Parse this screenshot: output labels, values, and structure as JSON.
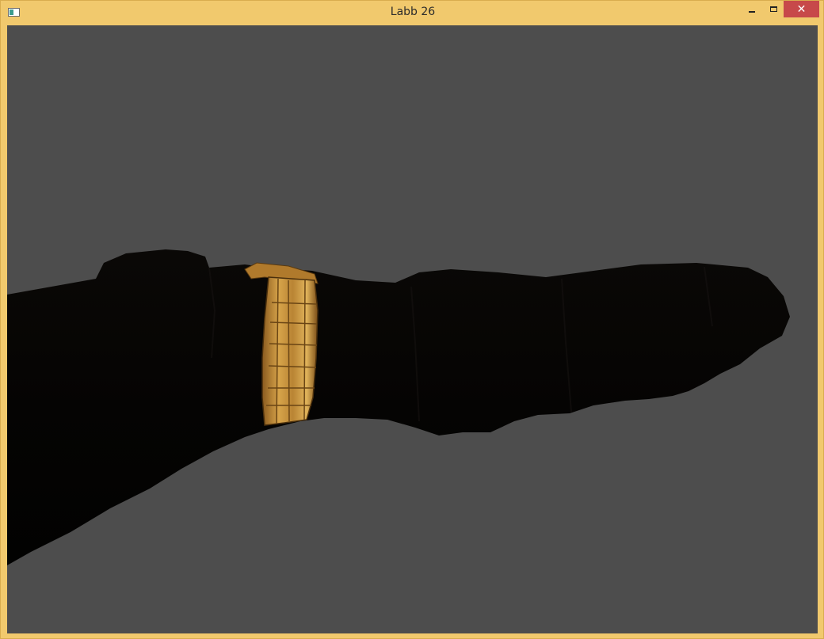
{
  "window": {
    "title": "Labb 26",
    "icons": {
      "app": "app-window-icon",
      "minimize": "minimize-icon",
      "maximize": "maximize-icon",
      "close": "close-icon"
    },
    "controls": {
      "close_glyph": "✕"
    },
    "colors": {
      "frame": "#f1c96d",
      "close": "#c7494a",
      "viewport_background": "#4d4d4d",
      "arm": "#050403",
      "watch_gold": "#c8953f"
    }
  }
}
